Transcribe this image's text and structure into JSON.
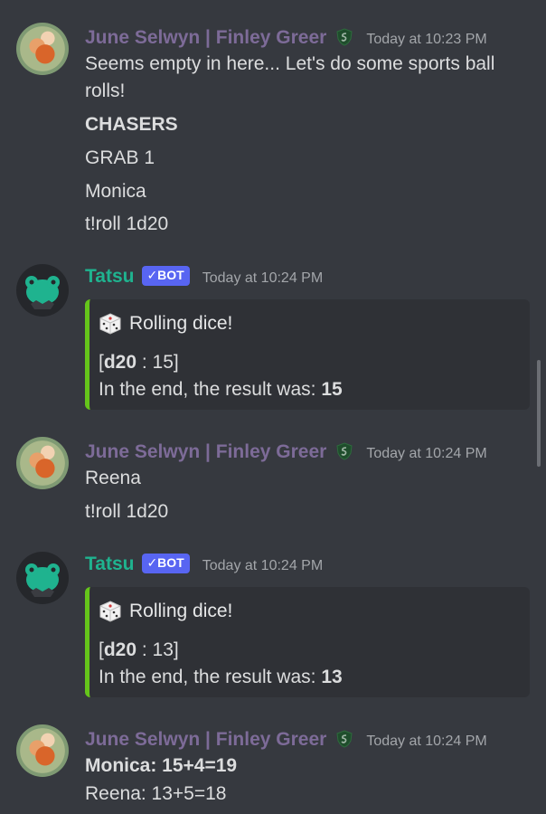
{
  "messages": [
    {
      "author": "June Selwyn | Finley Greer",
      "timestamp": "Today at 10:23 PM",
      "lines": [
        "Seems empty in here... Let's do some sports ball",
        "rolls!",
        "CHASERS",
        "GRAB 1",
        "Monica",
        "t!roll 1d20"
      ]
    },
    {
      "author": "Tatsu",
      "bot_tag": "✓BOT",
      "timestamp": "Today at 10:24 PM",
      "embed": {
        "title": "Rolling dice!",
        "roll_open": "[",
        "roll_die": "d20",
        "roll_sep": " : 15]",
        "result_prefix": "In the end, the result was: ",
        "result_value": "15"
      }
    },
    {
      "author": "June Selwyn | Finley Greer",
      "timestamp": "Today at 10:24 PM",
      "lines": [
        "Reena",
        "t!roll 1d20"
      ]
    },
    {
      "author": "Tatsu",
      "bot_tag": "✓BOT",
      "timestamp": "Today at 10:24 PM",
      "embed": {
        "title": "Rolling dice!",
        "roll_open": "[",
        "roll_die": "d20",
        "roll_sep": " : 13]",
        "result_prefix": "In the end, the result was: ",
        "result_value": "13"
      }
    },
    {
      "author": "June Selwyn | Finley Greer",
      "timestamp": "Today at 10:24 PM",
      "lines": [
        "Monica: 15+4=19",
        "Reena: 13+5=18"
      ]
    }
  ],
  "colors": {
    "background": "#36393f",
    "embed_background": "#2f3136",
    "embed_accent": "#65c51b",
    "june_name": "#7d6b98",
    "tatsu_name": "#1fb38f",
    "bot_tag": "#5865f2"
  },
  "icons": {
    "role": "slytherin-crest-icon",
    "embed": "dice-icon"
  }
}
